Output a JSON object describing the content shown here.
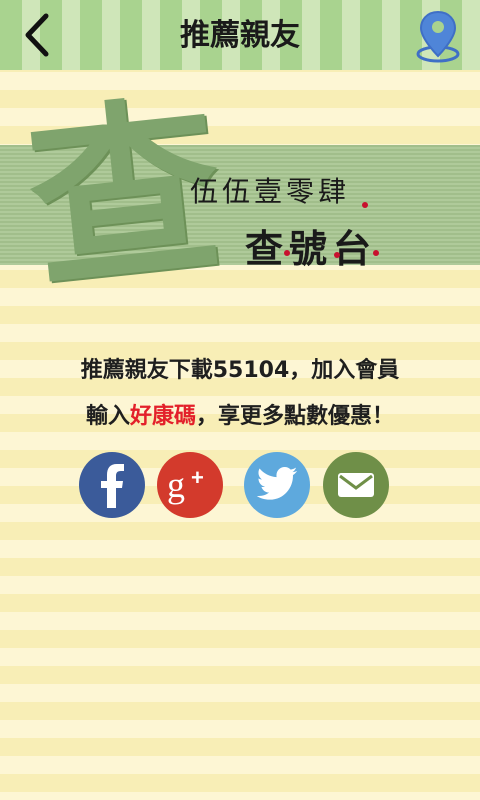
{
  "header": {
    "title": "推薦親友",
    "back_icon": "chevron-left-icon",
    "map_icon": "map-pin-icon"
  },
  "banner": {
    "big_char": "查",
    "line1": "伍伍壹零肆",
    "line2": "查號台"
  },
  "promo": {
    "line1": "推薦親友下載55104，加入會員",
    "line2_prefix": "輸入",
    "line2_highlight": "好康碼",
    "line2_suffix": "，享更多點數優惠！"
  },
  "share": {
    "facebook_icon": "facebook-icon",
    "googleplus_icon": "google-plus-icon",
    "twitter_icon": "twitter-icon",
    "email_icon": "email-icon"
  },
  "colors": {
    "header_green": "#a9d38f",
    "highlight_red": "#e3202a",
    "facebook": "#3b5b9a",
    "googleplus": "#d33a2c",
    "twitter": "#5ea9dd",
    "email": "#6f8f48"
  }
}
